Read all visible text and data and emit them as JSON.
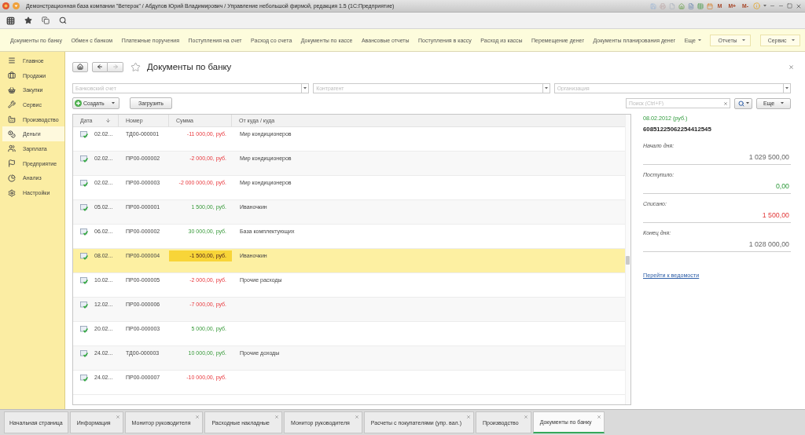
{
  "window": {
    "title": "Демонстрационная база компании \"Ветерок\" / Абдулов Юрий Владимирович / Управление небольшой фирмой, редакция 1.5 (1С:Предприятие)",
    "memory_buttons": [
      "M",
      "M+",
      "M-"
    ]
  },
  "section_nav": {
    "items": [
      "Документы по банку",
      "Обмен с банком",
      "Платежные поручения",
      "Поступления на счет",
      "Расход со счета",
      "Документы по кассе",
      "Авансовые отчеты",
      "Поступления в кассу",
      "Расход из кассы",
      "Перемещение денег",
      "Документы планирования денег"
    ],
    "more": "Еще",
    "menus": [
      "Отчеты",
      "Сервис"
    ]
  },
  "sidebar": {
    "items": [
      {
        "label": "Главное",
        "selected": false
      },
      {
        "label": "Продажи",
        "selected": false
      },
      {
        "label": "Закупки",
        "selected": false
      },
      {
        "label": "Сервис",
        "selected": false
      },
      {
        "label": "Производство",
        "selected": false
      },
      {
        "label": "Деньги",
        "selected": true
      },
      {
        "label": "Зарплата",
        "selected": false
      },
      {
        "label": "Предприятие",
        "selected": false
      },
      {
        "label": "Анализ",
        "selected": false
      },
      {
        "label": "Настройки",
        "selected": false
      }
    ]
  },
  "form": {
    "title": "Документы по банку",
    "favorite": false,
    "history": {
      "back_disabled": false,
      "forward_disabled": true
    },
    "filters": [
      {
        "placeholder": "Банковский счет"
      },
      {
        "placeholder": "Контрагент"
      },
      {
        "placeholder": "Организация"
      }
    ],
    "commands": {
      "create": "Создать",
      "load": "Загрузить",
      "search": {
        "placeholder": "Поиск (Ctrl+F)"
      },
      "more": "Еще"
    },
    "table": {
      "columns": [
        {
          "label": "Дата",
          "sorted": true
        },
        {
          "label": "Номер",
          "sorted": false
        },
        {
          "label": "Сумма",
          "sorted": false
        },
        {
          "label": "От куда / куда",
          "sorted": false
        }
      ],
      "rows": [
        {
          "date": "02.02...",
          "number": "ТД00-000001",
          "amount": "-11 000,00, руб.",
          "kind": "expense",
          "counterparty": "Мир кондиционеров",
          "selected": false
        },
        {
          "date": "02.02...",
          "number": "ПР00-000002",
          "amount": "-2 000,00, руб.",
          "kind": "expense",
          "counterparty": "Мир кондиционеров",
          "selected": false
        },
        {
          "date": "02.02...",
          "number": "ПР00-000003",
          "amount": "-2 000 000,00, руб.",
          "kind": "expense",
          "counterparty": "Мир кондиционеров",
          "selected": false
        },
        {
          "date": "05.02...",
          "number": "ПР00-000001",
          "amount": "1 500,00, руб.",
          "kind": "income",
          "counterparty": "Иваночкин",
          "selected": false
        },
        {
          "date": "06.02...",
          "number": "ПР00-000002",
          "amount": "30 000,00, руб.",
          "kind": "income",
          "counterparty": "База комплектующих",
          "selected": false
        },
        {
          "date": "08.02...",
          "number": "ПР00-000004",
          "amount": "-1 500,00, руб.",
          "kind": "expense",
          "counterparty": "Иваночкин",
          "selected": true
        },
        {
          "date": "10.02...",
          "number": "ПР00-000005",
          "amount": "-2 000,00, руб.",
          "kind": "expense",
          "counterparty": "Прочие расходы",
          "selected": false
        },
        {
          "date": "12.02...",
          "number": "ПР00-000006",
          "amount": "-7 000,00, руб.",
          "kind": "expense",
          "selected": false
        },
        {
          "date": "20.02...",
          "number": "ПР00-000003",
          "amount": "5 000,00, руб.",
          "kind": "income",
          "selected": false
        },
        {
          "date": "24.02...",
          "number": "ТД00-000003",
          "amount": "10 000,00, руб.",
          "kind": "income",
          "counterparty": "Прочие доходы",
          "selected": false
        },
        {
          "date": "24.02...",
          "number": "ПР00-000007",
          "amount": "-10 000,00, руб.",
          "kind": "expense",
          "selected": false
        }
      ]
    },
    "balance": {
      "caption": "08.02.2012 (руб.)",
      "account": "60851225062254412545",
      "lines": [
        {
          "label": "Начало дня:",
          "value": "1 029 500,00",
          "kind": "neutral"
        },
        {
          "label": "Поступило:",
          "value": "0,00",
          "kind": "income"
        },
        {
          "label": "Списано:",
          "value": "1 500,00",
          "kind": "expense"
        },
        {
          "label": "Конец дня:",
          "value": "1 028 000,00",
          "kind": "neutral"
        }
      ],
      "link": "Перейти к ведомости"
    }
  },
  "open_tabs": [
    {
      "label": "Начальная страница",
      "selected": false,
      "closable": false
    },
    {
      "label": "Информация",
      "selected": false,
      "closable": true
    },
    {
      "label": "Монитор руководителя",
      "selected": false,
      "closable": true
    },
    {
      "label": "Расходные накладные",
      "selected": false,
      "closable": true
    },
    {
      "label": "Монитор руководителя",
      "selected": false,
      "closable": true
    },
    {
      "label": "Расчеты с покупателями (упр. вал.)",
      "selected": false,
      "closable": true
    },
    {
      "label": "Производство",
      "selected": false,
      "closable": true
    },
    {
      "label": "Документы по банку",
      "selected": true,
      "closable": true
    }
  ]
}
